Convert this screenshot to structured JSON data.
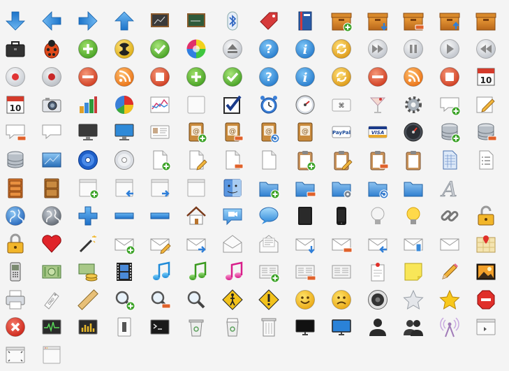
{
  "sheet": {
    "background": "#f4f4f4",
    "rows": [
      [
        "arrow-down-icon",
        "arrow-left-icon",
        "arrow-right-icon",
        "arrow-up-icon",
        "chalkboard-icon",
        "chalkboard-green-icon",
        "bluetooth-icon",
        "tag-icon",
        "book-icon",
        "box-add-icon",
        "box-download-icon",
        "box-remove-icon",
        "box-upload-icon",
        "box-icon"
      ],
      [
        "briefcase-icon",
        "bug-icon",
        "add-circle-icon",
        "radiation-icon",
        "check-circle-icon",
        "color-wheel-icon",
        "eject-icon",
        "help-icon",
        "info-icon",
        "refresh-icon",
        "fast-forward-icon",
        "pause-icon",
        "play-icon",
        "rewind-icon"
      ],
      [
        "record-icon",
        "record-gray-icon",
        "remove-circle-icon",
        "rss-icon",
        "stop-icon",
        "add-circle-icon",
        "check-circle-icon",
        "help-icon",
        "info-icon",
        "refresh-icon",
        "remove-circle-icon",
        "rss-icon",
        "stop-icon",
        "calendar-icon"
      ],
      [
        "calendar-icon",
        "camera-icon",
        "bar-chart-icon",
        "pie-chart-icon",
        "line-chart-icon",
        "blank-icon",
        "checkbox-checked-icon",
        "alarm-clock-icon",
        "gauge-icon",
        "keyboard-key-icon",
        "cocktail-icon",
        "gear-icon",
        "comment-add-icon",
        "edit-icon"
      ],
      [
        "comment-remove-icon",
        "comment-icon",
        "monitor-icon",
        "monitor-blue-icon",
        "id-card-icon",
        "address-book-add-icon",
        "address-book-remove-icon",
        "address-book-refresh-icon",
        "address-book-icon",
        "paypal-icon",
        "visa-icon",
        "dashboard-icon",
        "database-add-icon",
        "database-remove-icon"
      ],
      [
        "database-icon",
        "desktop-icon",
        "cd-blue-icon",
        "cd-icon",
        "document-add-icon",
        "document-edit-icon",
        "document-remove-icon",
        "document-icon",
        "clipboard-add-icon",
        "clipboard-edit-icon",
        "clipboard-remove-icon",
        "clipboard-icon",
        "spreadsheet-icon",
        "checklist-icon"
      ],
      [
        "drawer-icon",
        "drawer-wood-icon",
        "window-add-icon",
        "window-back-icon",
        "window-forward-icon",
        "window-icon",
        "finder-icon",
        "folder-add-icon",
        "folder-remove-icon",
        "folder-settings-icon",
        "folder-refresh-icon",
        "folder-icon",
        "font-icon"
      ],
      [
        "globe-blue-icon",
        "globe-gray-icon",
        "plus-blue-icon",
        "minus-blue-icon",
        "minus-blue-icon",
        "home-icon",
        "video-chat-icon",
        "chat-bubble-icon",
        "tablet-icon",
        "phone-icon",
        "bulb-off-icon",
        "bulb-on-icon",
        "link-icon",
        "lock-open-icon"
      ],
      [
        "lock-icon",
        "heart-icon",
        "magic-wand-icon",
        "mail-add-icon",
        "mail-edit-icon",
        "mail-forward-icon",
        "mail-open-icon",
        "mail-letter-icon",
        "mail-download-icon",
        "mail-remove-icon",
        "mail-reply-icon",
        "mail-attachment-icon",
        "mail-icon",
        "map-icon"
      ],
      [
        "mobile-phone-icon",
        "money-icon",
        "money-coins-icon",
        "film-icon",
        "music-note-blue-icon",
        "music-note-green-icon",
        "music-note-pink-icon",
        "newspaper-add-icon",
        "newspaper-remove-icon",
        "newspaper-icon",
        "note-pin-icon",
        "sticky-note-icon",
        "pencil-icon",
        "photo-icon"
      ],
      [
        "printer-icon",
        "dnd-tag-icon",
        "ruler-icon",
        "zoom-in-icon",
        "zoom-out-icon",
        "search-icon",
        "pedestrian-sign-icon",
        "warning-icon",
        "smile-icon",
        "sad-icon",
        "speaker-icon",
        "star-empty-icon",
        "star-icon",
        "stop-sign-icon"
      ],
      [
        "close-icon",
        "activity-monitor-icon",
        "equalizer-icon",
        "switch-icon",
        "terminal-icon",
        "trash-icon",
        "trash-full-icon",
        "trash-white-icon",
        "tv-icon",
        "tv-blue-icon",
        "user-icon",
        "users-icon",
        "antenna-icon",
        "application-icon"
      ],
      [
        "fullscreen-window-icon",
        "window-small-icon"
      ]
    ]
  }
}
